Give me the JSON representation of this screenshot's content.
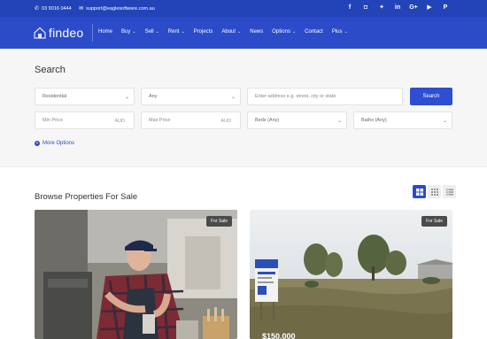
{
  "topbar": {
    "phone": "03 9016 0444",
    "email": "support@eaglesoftware.com.au",
    "social": [
      {
        "icon": "facebook-icon",
        "glyph": "f"
      },
      {
        "icon": "foursquare-icon",
        "glyph": "◘"
      },
      {
        "icon": "twitter-icon",
        "glyph": "✦"
      },
      {
        "icon": "linkedin-icon",
        "glyph": "in"
      },
      {
        "icon": "google-plus-icon",
        "glyph": "G+"
      },
      {
        "icon": "youtube-icon",
        "glyph": "▶"
      },
      {
        "icon": "pinterest-icon",
        "glyph": "P"
      }
    ]
  },
  "nav": {
    "logo_text": "findeo",
    "items": [
      {
        "label": "Home",
        "has_dropdown": false
      },
      {
        "label": "Buy",
        "has_dropdown": true
      },
      {
        "label": "Sell",
        "has_dropdown": true
      },
      {
        "label": "Rent",
        "has_dropdown": true
      },
      {
        "label": "Projects",
        "has_dropdown": false
      },
      {
        "label": "About",
        "has_dropdown": true
      },
      {
        "label": "News",
        "has_dropdown": false
      },
      {
        "label": "Options",
        "has_dropdown": true
      },
      {
        "label": "Contact",
        "has_dropdown": false
      },
      {
        "label": "Plus",
        "has_dropdown": true
      }
    ]
  },
  "search": {
    "title": "Search",
    "type_value": "Residential",
    "any_value": "Any",
    "address_placeholder": "Enter address e.g. street, city or state",
    "button_label": "Search",
    "min_price_placeholder": "Min Price",
    "max_price_placeholder": "Max Price",
    "currency": "AUD",
    "beds_value": "Beds (Any)",
    "baths_value": "Baths (Any)",
    "more_options_label": "More Options"
  },
  "browse": {
    "title": "Browse Properties For Sale",
    "views": [
      "grid-view",
      "grid-compact-view",
      "list-view"
    ],
    "active_view": "grid-view",
    "cards": [
      {
        "badge": "For Sale",
        "price": ""
      },
      {
        "badge": "For Sale",
        "price": "$150,000"
      }
    ]
  },
  "colors": {
    "brand": "#2b4bc9",
    "topbar": "#2343b8",
    "badge": "#4b4b4b"
  }
}
